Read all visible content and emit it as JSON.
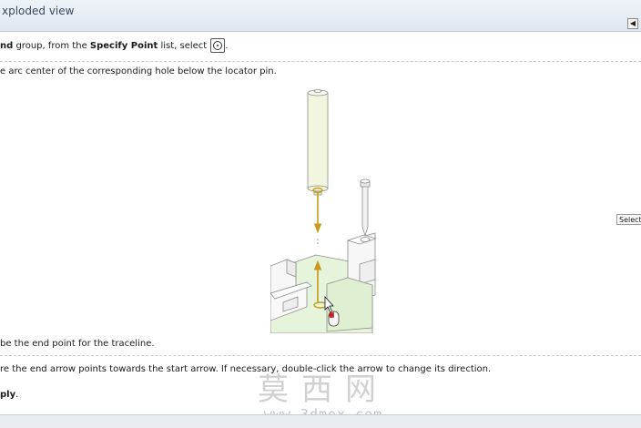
{
  "header": {
    "title": "xploded view",
    "back_glyph": "◀"
  },
  "steps": {
    "s1_a": "nd",
    "s1_b": " group, from the ",
    "s1_c": "Specify Point",
    "s1_d": " list, select ",
    "s1_e": ".",
    "s2": "e arc center of the corresponding hole below the locator pin.",
    "s3": "be the end point for the traceline.",
    "s4": "re the end arrow points towards the start arrow. If necessary, double-click the arrow to change its direction.",
    "s5_a": "ply",
    "s5_b": "."
  },
  "tooltip": {
    "text": "Select t"
  },
  "watermark": {
    "chinese": "莫西网",
    "url": "www.3dmox.com"
  },
  "colors": {
    "accent_arrow": "#c69c1a",
    "model_green": "#e2f3d6",
    "pin_fill": "#f3f6df"
  },
  "icons": {
    "specify_point": "arc-center-point-icon"
  }
}
